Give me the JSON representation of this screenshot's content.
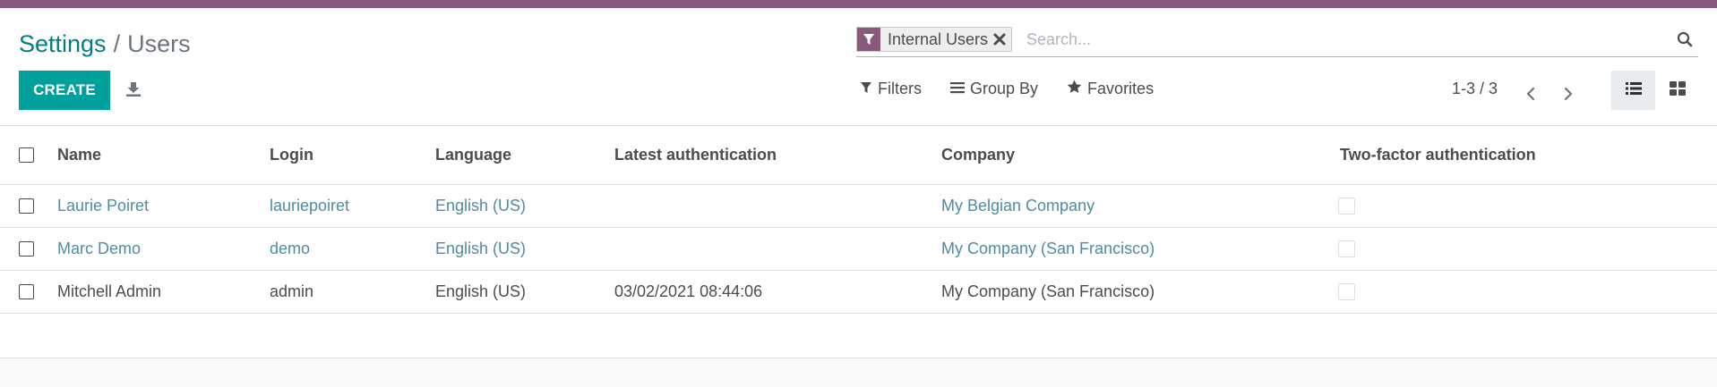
{
  "breadcrumb": {
    "parent": "Settings",
    "separator": "/",
    "current": "Users"
  },
  "search": {
    "facet_icon": "filter-icon",
    "facet_label": "Internal Users",
    "facet_remove_icon": "close-icon",
    "placeholder": "Search...",
    "search_icon": "search-icon"
  },
  "toolbar": {
    "create_label": "CREATE",
    "download_icon": "download-icon"
  },
  "search_options": {
    "filters_label": "Filters",
    "group_by_label": "Group By",
    "favorites_label": "Favorites"
  },
  "pager": {
    "value": "1-3 / 3"
  },
  "views": {
    "active": "list",
    "list_icon": "list-view-icon",
    "kanban_icon": "kanban-view-icon"
  },
  "columns": {
    "name": "Name",
    "login": "Login",
    "language": "Language",
    "latest_authentication": "Latest authentication",
    "company": "Company",
    "two_factor": "Two-factor authentication"
  },
  "rows": [
    {
      "name": "Laurie Poiret",
      "login": "lauriepoiret",
      "language": "English (US)",
      "latest_authentication": "",
      "company": "My Belgian Company",
      "two_factor": false,
      "muted": true
    },
    {
      "name": "Marc Demo",
      "login": "demo",
      "language": "English (US)",
      "latest_authentication": "",
      "company": "My Company (San Francisco)",
      "two_factor": false,
      "muted": true
    },
    {
      "name": "Mitchell Admin",
      "login": "admin",
      "language": "English (US)",
      "latest_authentication": "03/02/2021 08:44:06",
      "company": "My Company (San Francisco)",
      "two_factor": false,
      "muted": false
    }
  ],
  "colors": {
    "brand": "#875a7b",
    "primary_button": "#00a09d",
    "breadcrumb_link": "#017e84",
    "row_link": "#4f8ca0"
  }
}
